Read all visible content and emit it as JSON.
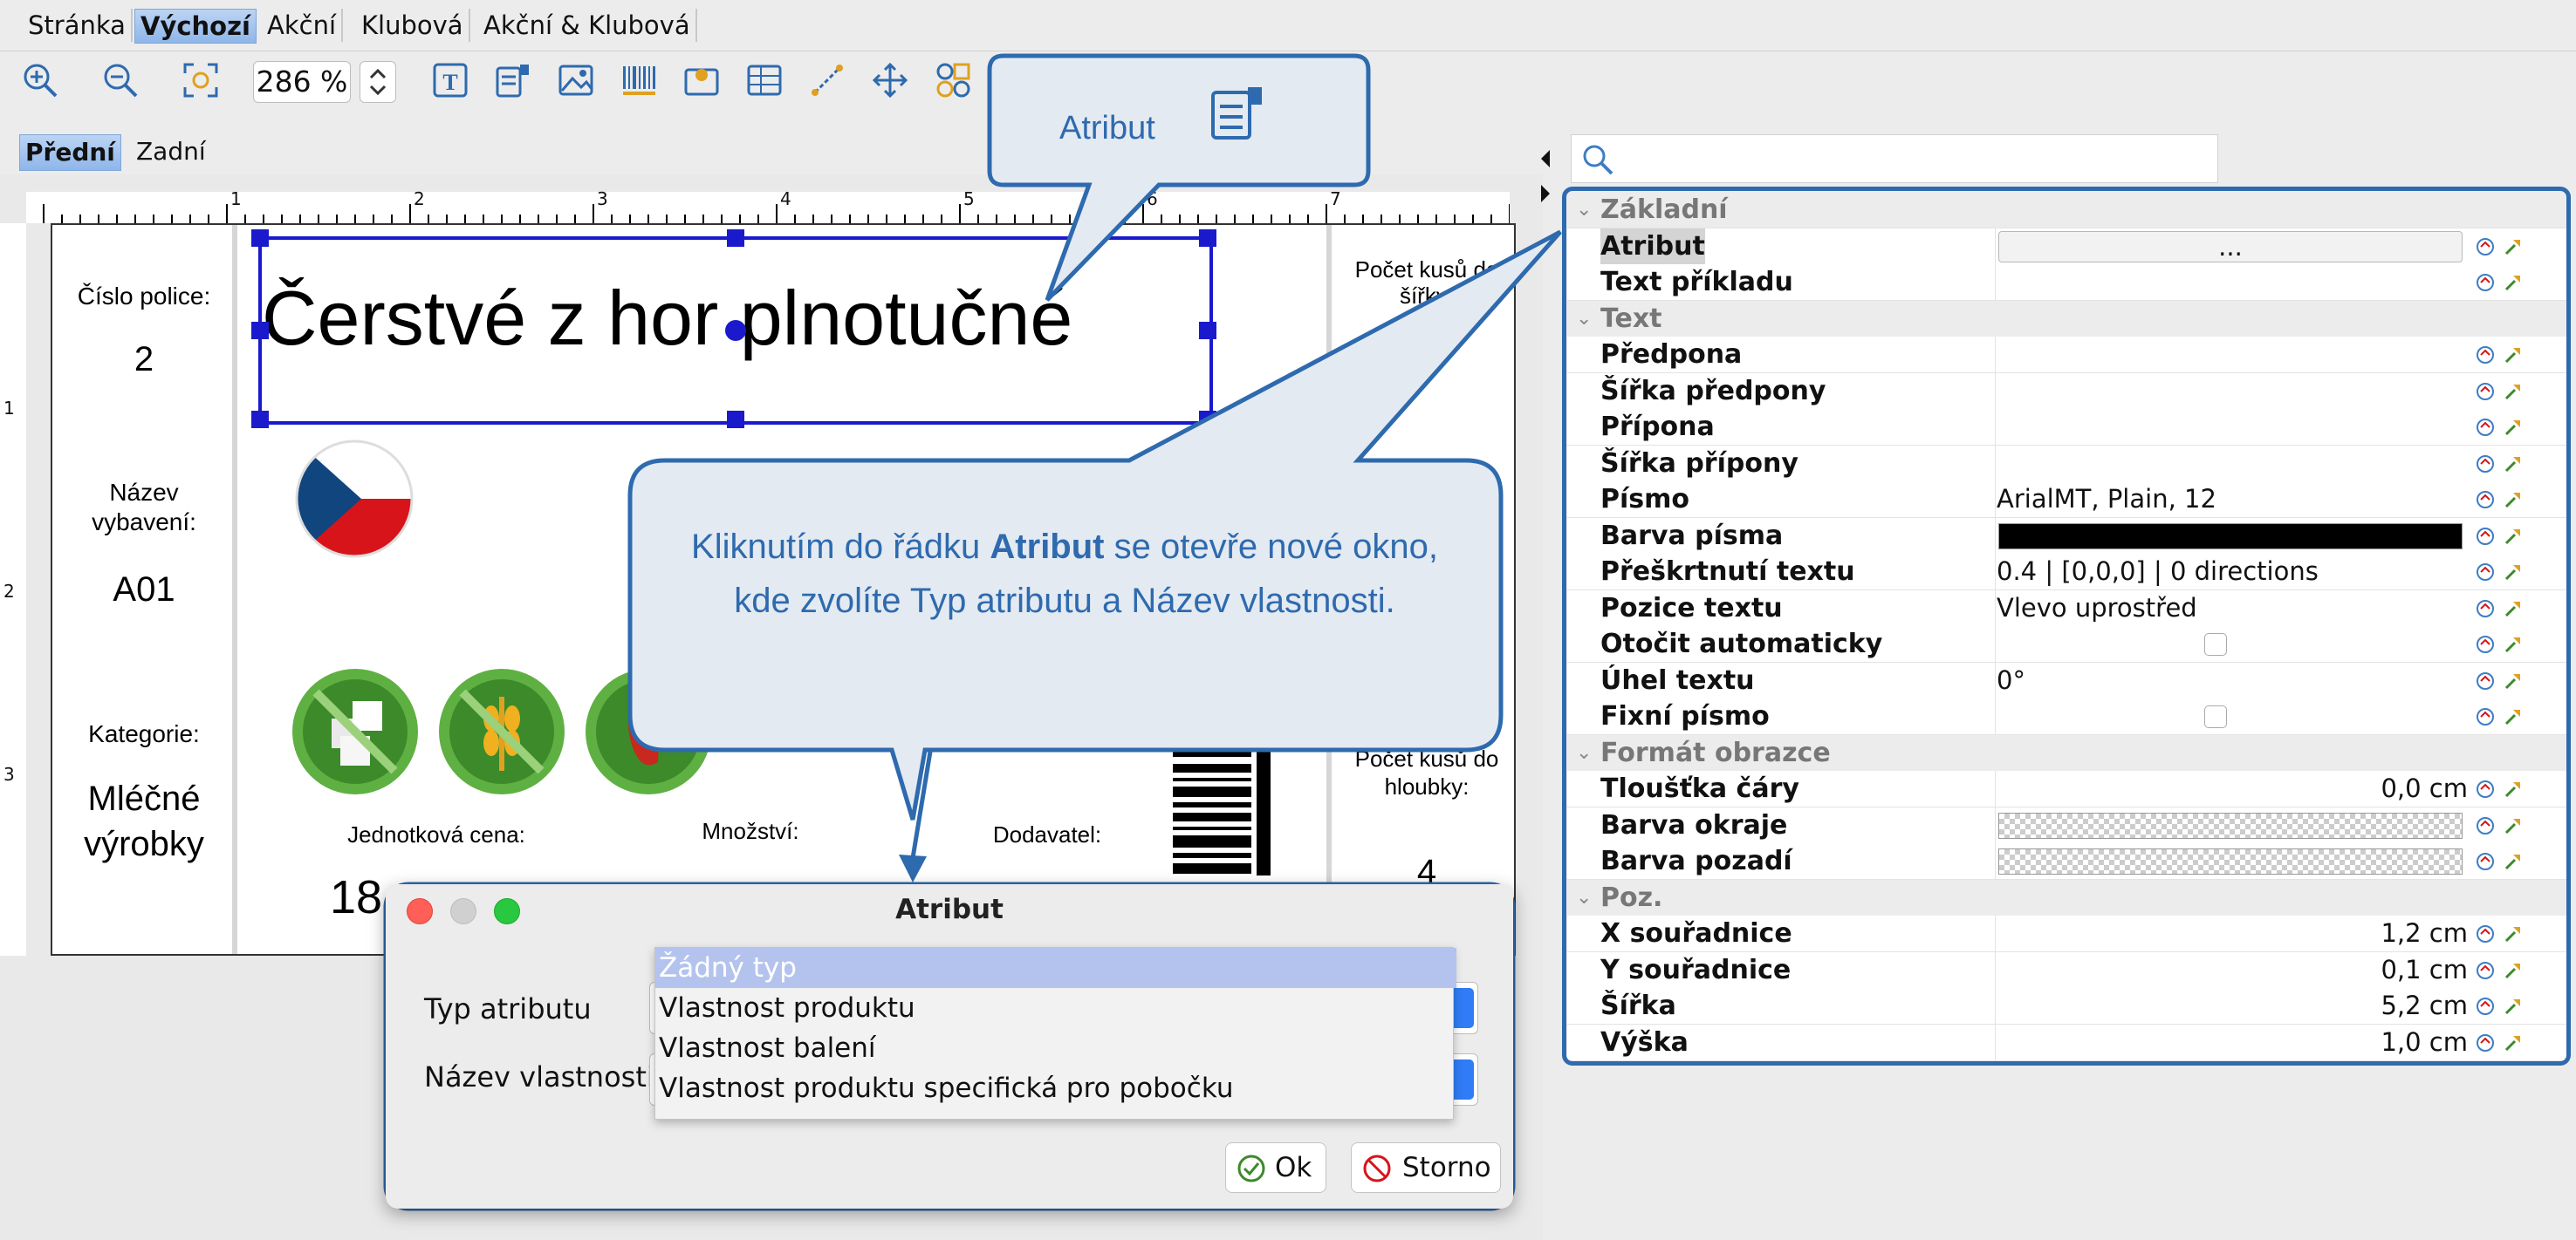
{
  "top_tabs": [
    "Stránka",
    "Výchozí",
    "Akční",
    "Klubová",
    "Akční & Klubová"
  ],
  "toolbar": {
    "zoom_value": "286 %",
    "icons": [
      "zoom-in-icon",
      "zoom-out-icon",
      "fit-icon",
      "text-field-icon",
      "attribute-icon",
      "image-icon",
      "barcode-icon",
      "map-pin-icon",
      "table-icon",
      "line-icon",
      "move-icon",
      "shapes-icon"
    ]
  },
  "face_tabs": [
    "Přední",
    "Zadní"
  ],
  "ruler": {
    "top_numbers": [
      "1",
      "2",
      "3",
      "4",
      "5",
      "6",
      "7"
    ],
    "left_numbers": [
      "1",
      "2",
      "3"
    ]
  },
  "label": {
    "shelf_label": "Číslo police:",
    "shelf_value": "2",
    "product_name": "Čerstvé z hor plnotučné",
    "equip_label": "Název vybavení:",
    "equip_value": "A01",
    "category_label": "Kategorie:",
    "category_value": "Mléčné výrobky",
    "unit_price_label": "Jednotková cena:",
    "unit_price_value": "18",
    "quantity_label": "Množství:",
    "supplier_label": "Dodavatel:",
    "width_count_label": "Počet kusů do šířky:",
    "depth_count_label": "Počet kusů do hloubky:",
    "depth_count_value": "4"
  },
  "callouts": {
    "attribute_title": "Atribut",
    "info_text_before": "Kliknutím do řádku",
    "info_text_bold": "Atribut",
    "info_text_after": "se otevře nové okno, kde zvolíte Typ atributu a Název vlastnosti."
  },
  "properties": {
    "rows": [
      {
        "kind": "group",
        "name": "Základní"
      },
      {
        "kind": "prop",
        "name": "Atribut",
        "value": "...",
        "selected": true
      },
      {
        "kind": "prop",
        "name": "Text příkladu",
        "value": ""
      },
      {
        "kind": "group",
        "name": "Text"
      },
      {
        "kind": "prop",
        "name": "Předpona",
        "value": ""
      },
      {
        "kind": "prop",
        "name": "Šířka předpony",
        "value": ""
      },
      {
        "kind": "prop",
        "name": "Přípona",
        "value": ""
      },
      {
        "kind": "prop",
        "name": "Šířka přípony",
        "value": ""
      },
      {
        "kind": "prop",
        "name": "Písmo",
        "value": "ArialMT, Plain, 12"
      },
      {
        "kind": "prop",
        "name": "Barva písma",
        "value": "",
        "swatch": "#000000"
      },
      {
        "kind": "prop",
        "name": "Přeškrtnutí textu",
        "value": "0.4 | [0,0,0] | 0 directions"
      },
      {
        "kind": "prop",
        "name": "Pozice textu",
        "value": "Vlevo uprostřed"
      },
      {
        "kind": "prop",
        "name": "Otočit automaticky",
        "value": "",
        "checkbox": true
      },
      {
        "kind": "prop",
        "name": "Úhel textu",
        "value": "0°"
      },
      {
        "kind": "prop",
        "name": "Fixní písmo",
        "value": "",
        "checkbox": true
      },
      {
        "kind": "group",
        "name": "Formát obrazce"
      },
      {
        "kind": "prop",
        "name": "Tloušťka čáry",
        "value": "0,0 cm",
        "align": "right"
      },
      {
        "kind": "prop",
        "name": "Barva okraje",
        "value": "",
        "swatch": "checker"
      },
      {
        "kind": "prop",
        "name": "Barva pozadí",
        "value": "",
        "swatch": "checker"
      },
      {
        "kind": "group",
        "name": "Poz."
      },
      {
        "kind": "prop",
        "name": "X souřadnice",
        "value": "1,2 cm",
        "align": "right"
      },
      {
        "kind": "prop",
        "name": "Y souřadnice",
        "value": "0,1 cm",
        "align": "right"
      },
      {
        "kind": "prop",
        "name": "Šířka",
        "value": "5,2 cm",
        "align": "right"
      },
      {
        "kind": "prop",
        "name": "Výška",
        "value": "1,0 cm",
        "align": "right"
      }
    ]
  },
  "dialog": {
    "title": "Atribut",
    "type_label": "Typ atributu",
    "name_label": "Název vlastnosti",
    "options": [
      "Žádný typ",
      "Vlastnost produktu",
      "Vlastnost balení",
      "Vlastnost produktu specifická pro pobočku"
    ],
    "selected_option": "Žádný typ",
    "ok_label": "Ok",
    "cancel_label": "Storno"
  },
  "colors": {
    "accent": "#2e6aae",
    "selection": "#1a1acc",
    "highlight": "#b4c3ee"
  }
}
